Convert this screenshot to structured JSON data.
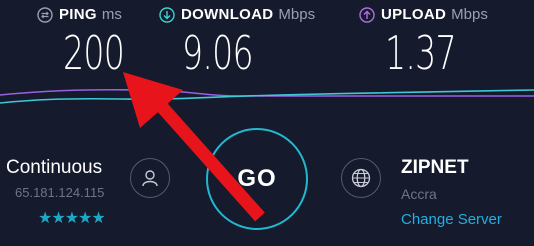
{
  "metrics": {
    "ping": {
      "label": "PING",
      "unit": "ms",
      "value": "200",
      "icon": "ping-icon",
      "color": "#9aa0b4"
    },
    "download": {
      "label": "DOWNLOAD",
      "unit": "Mbps",
      "value": "9.06",
      "icon": "download-arrow-icon",
      "color": "#3fd0cf"
    },
    "upload": {
      "label": "UPLOAD",
      "unit": "Mbps",
      "value": "1.37",
      "icon": "upload-arrow-icon",
      "color": "#b26dde"
    }
  },
  "graph": {
    "download_color": "#3fc8d8",
    "upload_color": "#9b61e0"
  },
  "connection": {
    "name": "Continuous",
    "ip": "65.181.124.115",
    "rating": "★★★★★",
    "icon": "user-icon"
  },
  "go_button": {
    "label": "GO",
    "ring_color": "#22b8cf"
  },
  "server": {
    "name": "ZIPNET",
    "location": "Accra",
    "change_label": "Change Server",
    "icon": "globe-icon"
  },
  "annotation": {
    "type": "red-arrow",
    "color": "#e8141b",
    "points_to": "ping-value"
  }
}
